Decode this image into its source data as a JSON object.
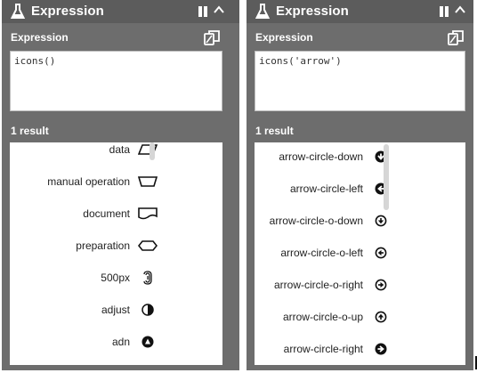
{
  "panels": [
    {
      "title": "Expression",
      "expression_label": "Expression",
      "expression_value": "icons()",
      "result_count": "1 result",
      "items": [
        {
          "label": "data",
          "icon": "parallelogram-icon"
        },
        {
          "label": "manual operation",
          "icon": "trapezoid-icon"
        },
        {
          "label": "document",
          "icon": "document-shape-icon"
        },
        {
          "label": "preparation",
          "icon": "hexagon-icon"
        },
        {
          "label": "500px",
          "icon": "500px-icon"
        },
        {
          "label": "adjust",
          "icon": "adjust-icon"
        },
        {
          "label": "adn",
          "icon": "adn-icon"
        }
      ]
    },
    {
      "title": "Expression",
      "expression_label": "Expression",
      "expression_value": "icons('arrow')",
      "result_count": "1 result",
      "items": [
        {
          "label": "arrow-circle-down",
          "icon": "arrow-circle-down-icon"
        },
        {
          "label": "arrow-circle-left",
          "icon": "arrow-circle-left-icon"
        },
        {
          "label": "arrow-circle-o-down",
          "icon": "arrow-circle-o-down-icon"
        },
        {
          "label": "arrow-circle-o-left",
          "icon": "arrow-circle-o-left-icon"
        },
        {
          "label": "arrow-circle-o-right",
          "icon": "arrow-circle-o-right-icon"
        },
        {
          "label": "arrow-circle-o-up",
          "icon": "arrow-circle-o-up-icon"
        },
        {
          "label": "arrow-circle-right",
          "icon": "arrow-circle-right-icon"
        }
      ]
    }
  ],
  "colors": {
    "panel_bg": "#6d6d6d",
    "title_bg": "#5c5c5c",
    "text": "#222222"
  }
}
